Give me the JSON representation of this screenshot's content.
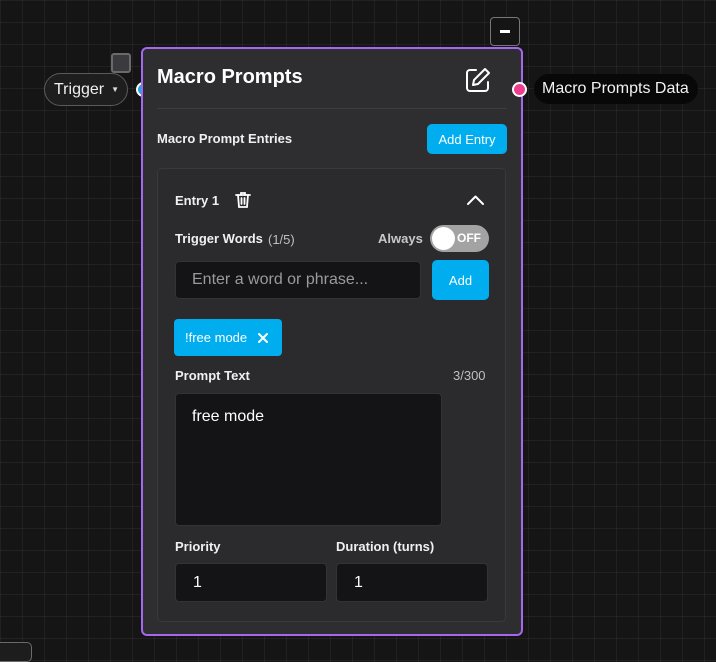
{
  "colors": {
    "canvas": "#151515",
    "node_border": "#a566f0",
    "node_bg": "#2e2e30",
    "accent": "#00aef0",
    "input_port": "#19a7e6",
    "output_port": "#ee3d8d",
    "toggle_off": "#a3a3a3"
  },
  "input": {
    "label": "Trigger",
    "icon": "chevron-down-icon"
  },
  "output": {
    "label": "Macro Prompts Data"
  },
  "node": {
    "title": "Macro Prompts",
    "edit_icon": "edit-icon",
    "minimize_icon": "minus-icon",
    "section_label": "Macro Prompt Entries",
    "add_entry_label": "Add Entry",
    "entry": {
      "title": "Entry 1",
      "delete_icon": "trash-icon",
      "collapse_icon": "chevron-up-icon",
      "trigger_words_label": "Trigger Words",
      "trigger_words_count": "(1/5)",
      "always_label": "Always",
      "always_toggle": {
        "state": "OFF",
        "on": false
      },
      "word_input": {
        "value": "",
        "placeholder": "Enter a word or phrase..."
      },
      "add_word_label": "Add",
      "chips": [
        {
          "label": "!free mode",
          "remove_icon": "close-icon"
        }
      ],
      "prompt_text_label": "Prompt Text",
      "prompt_text_count": "3/300",
      "prompt_text_value": "free mode",
      "priority_label": "Priority",
      "priority_value": "1",
      "duration_label": "Duration (turns)",
      "duration_value": "1"
    }
  }
}
